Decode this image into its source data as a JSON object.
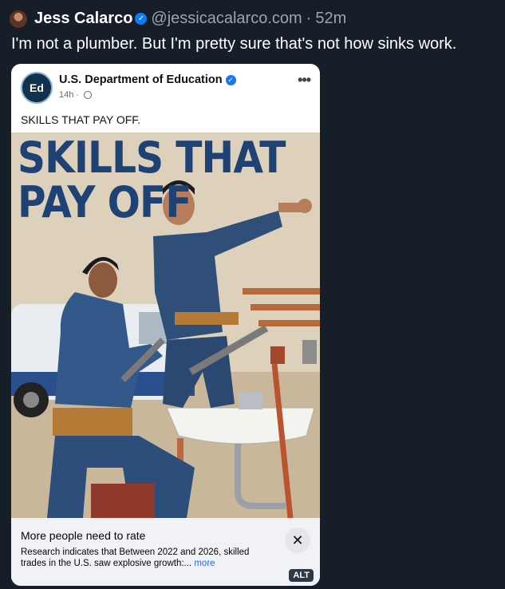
{
  "post": {
    "author_name": "Jess Calarco",
    "handle": "@jessicacalarco.com",
    "separator": "·",
    "timestamp": "52m",
    "text": "I'm not a plumber. But I'm pretty sure that's not how sinks work."
  },
  "embed": {
    "page_name": "U.S. Department of Education",
    "logo_text": "Ed",
    "post_time": "14h",
    "post_separator": "·",
    "more_icon": "more-horizontal-icon",
    "caption": "SKILLS THAT PAY OFF.",
    "image": {
      "headline_line1": "SKILLS THAT",
      "headline_line2": "PAY OFF"
    },
    "footer": {
      "title": "More people need to rate",
      "description": "Research indicates that Between 2022 and 2026, skilled trades in the U.S. saw explosive growth:...",
      "more_link": "more",
      "close_icon": "close-icon",
      "alt_badge": "ALT"
    }
  },
  "colors": {
    "background": "#161e27",
    "verified_blue": "#0a7aff",
    "headline_blue": "#1e4274",
    "link_blue": "#216fdb"
  }
}
